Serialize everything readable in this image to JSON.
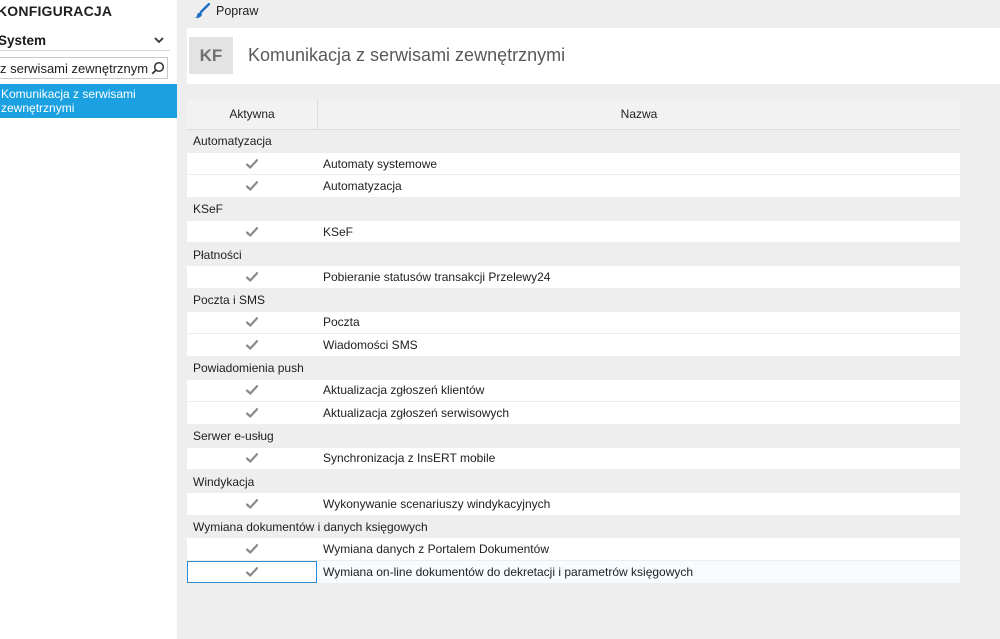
{
  "app": {
    "title": "KONFIGURACJA"
  },
  "sidebar": {
    "module_select": {
      "value": "System"
    },
    "search": {
      "value": "z serwisami zewnętrznymi"
    },
    "items": [
      {
        "label": "Komunikacja z serwisami zewnętrznymi",
        "selected": true
      }
    ]
  },
  "toolbar": {
    "fix_label": "Popraw"
  },
  "header": {
    "badge": "KF",
    "title": "Komunikacja z serwisami zewnętrznymi"
  },
  "table": {
    "columns": {
      "active": "Aktywna",
      "name": "Nazwa"
    },
    "groups": [
      {
        "name": "Automatyzacja",
        "rows": [
          {
            "active": true,
            "name": "Automaty systemowe"
          },
          {
            "active": true,
            "name": "Automatyzacja"
          }
        ]
      },
      {
        "name": "KSeF",
        "rows": [
          {
            "active": true,
            "name": "KSeF"
          }
        ]
      },
      {
        "name": "Płatności",
        "rows": [
          {
            "active": true,
            "name": "Pobieranie statusów transakcji Przelewy24"
          }
        ]
      },
      {
        "name": "Poczta i SMS",
        "rows": [
          {
            "active": true,
            "name": "Poczta"
          },
          {
            "active": true,
            "name": "Wiadomości SMS"
          }
        ]
      },
      {
        "name": "Powiadomienia push",
        "rows": [
          {
            "active": true,
            "name": "Aktualizacja zgłoszeń klientów"
          },
          {
            "active": true,
            "name": "Aktualizacja zgłoszeń serwisowych"
          }
        ]
      },
      {
        "name": "Serwer e-usług",
        "rows": [
          {
            "active": true,
            "name": "Synchronizacja z InsERT mobile"
          }
        ]
      },
      {
        "name": "Windykacja",
        "rows": [
          {
            "active": true,
            "name": "Wykonywanie scenariuszy windykacyjnych"
          }
        ]
      },
      {
        "name": "Wymiana dokumentów i danych księgowych",
        "rows": [
          {
            "active": true,
            "name": "Wymiana danych z Portalem Dokumentów"
          },
          {
            "active": true,
            "name": "Wymiana on-line dokumentów do dekretacji i parametrów księgowych",
            "selected": true
          }
        ]
      }
    ]
  },
  "colors": {
    "accent": "#1ba1e2",
    "check": "#8a8a8a",
    "brush": "#1f6fc4"
  },
  "icons": {
    "module_chevron": "chevron-down-icon",
    "search": "search-icon",
    "fix": "brush-icon",
    "active": "check-icon"
  }
}
